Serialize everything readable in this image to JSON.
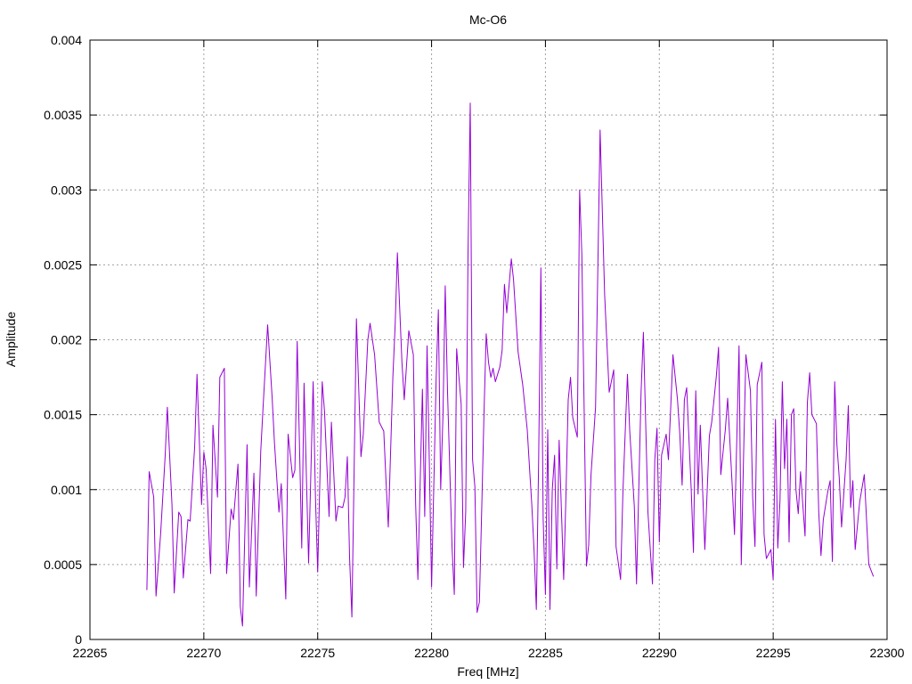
{
  "chart_data": {
    "type": "line",
    "title": "Mc-O6",
    "xlabel": "Freq [MHz]",
    "ylabel": "Amplitude",
    "xlim": [
      22265,
      22300
    ],
    "ylim": [
      0,
      0.004
    ],
    "xticks": [
      22265,
      22270,
      22275,
      22280,
      22285,
      22290,
      22295,
      22300
    ],
    "xtick_labels": [
      "22265",
      "22270",
      "22275",
      "22280",
      "22285",
      "22290",
      "22295",
      "22300"
    ],
    "yticks": [
      0,
      0.0005,
      0.001,
      0.0015,
      0.002,
      0.0025,
      0.003,
      0.0035,
      0.004
    ],
    "ytick_labels": [
      "0",
      "0.0005",
      "0.001",
      "0.0015",
      "0.002",
      "0.0025",
      "0.003",
      "0.0035",
      "0.004"
    ],
    "grid": true,
    "series": [
      {
        "color": "#9400d3",
        "points": [
          [
            22267.5,
            0.00033
          ],
          [
            22267.6,
            0.00112
          ],
          [
            22267.8,
            0.00095
          ],
          [
            22267.9,
            0.00029
          ],
          [
            22268.1,
            0.0007
          ],
          [
            22268.3,
            0.00122
          ],
          [
            22268.4,
            0.00155
          ],
          [
            22268.6,
            0.0009
          ],
          [
            22268.7,
            0.00031
          ],
          [
            22268.9,
            0.00085
          ],
          [
            22269.0,
            0.00082
          ],
          [
            22269.1,
            0.00041
          ],
          [
            22269.3,
            0.0008
          ],
          [
            22269.4,
            0.00079
          ],
          [
            22269.6,
            0.00129
          ],
          [
            22269.7,
            0.00177
          ],
          [
            22269.9,
            0.0009
          ],
          [
            22270.0,
            0.00125
          ],
          [
            22270.1,
            0.00114
          ],
          [
            22270.3,
            0.00044
          ],
          [
            22270.4,
            0.00143
          ],
          [
            22270.6,
            0.00095
          ],
          [
            22270.7,
            0.00175
          ],
          [
            22270.9,
            0.00181
          ],
          [
            22271.0,
            0.00044
          ],
          [
            22271.2,
            0.00087
          ],
          [
            22271.3,
            0.0008
          ],
          [
            22271.5,
            0.00117
          ],
          [
            22271.6,
            0.00022
          ],
          [
            22271.7,
            9e-05
          ],
          [
            22271.9,
            0.0013
          ],
          [
            22272.0,
            0.00035
          ],
          [
            22272.2,
            0.00111
          ],
          [
            22272.3,
            0.00029
          ],
          [
            22272.5,
            0.00126
          ],
          [
            22272.6,
            0.00154
          ],
          [
            22272.8,
            0.0021
          ],
          [
            22273.0,
            0.00161
          ],
          [
            22273.1,
            0.00132
          ],
          [
            22273.3,
            0.00085
          ],
          [
            22273.4,
            0.00104
          ],
          [
            22273.6,
            0.00027
          ],
          [
            22273.7,
            0.00137
          ],
          [
            22273.9,
            0.00108
          ],
          [
            22274.0,
            0.00113
          ],
          [
            22274.1,
            0.00199
          ],
          [
            22274.3,
            0.00061
          ],
          [
            22274.4,
            0.00171
          ],
          [
            22274.5,
            0.00112
          ],
          [
            22274.6,
            0.00051
          ],
          [
            22274.8,
            0.00172
          ],
          [
            22274.9,
            0.00095
          ],
          [
            22275.0,
            0.00045
          ],
          [
            22275.2,
            0.00172
          ],
          [
            22275.3,
            0.00152
          ],
          [
            22275.5,
            0.00082
          ],
          [
            22275.6,
            0.00145
          ],
          [
            22275.8,
            0.00079
          ],
          [
            22275.9,
            0.00089
          ],
          [
            22276.1,
            0.00088
          ],
          [
            22276.2,
            0.00095
          ],
          [
            22276.3,
            0.00122
          ],
          [
            22276.4,
            0.00055
          ],
          [
            22276.5,
            0.00015
          ],
          [
            22276.7,
            0.00214
          ],
          [
            22276.9,
            0.00122
          ],
          [
            22277.0,
            0.00137
          ],
          [
            22277.2,
            0.002
          ],
          [
            22277.3,
            0.00211
          ],
          [
            22277.5,
            0.0019
          ],
          [
            22277.7,
            0.00145
          ],
          [
            22277.9,
            0.00139
          ],
          [
            22278.0,
            0.00106
          ],
          [
            22278.1,
            0.00075
          ],
          [
            22278.3,
            0.00175
          ],
          [
            22278.4,
            0.0021
          ],
          [
            22278.5,
            0.00258
          ],
          [
            22278.7,
            0.00185
          ],
          [
            22278.8,
            0.0016
          ],
          [
            22279.0,
            0.00206
          ],
          [
            22279.2,
            0.0019
          ],
          [
            22279.3,
            0.0009
          ],
          [
            22279.4,
            0.0004
          ],
          [
            22279.6,
            0.00167
          ],
          [
            22279.7,
            0.00082
          ],
          [
            22279.8,
            0.00196
          ],
          [
            22279.9,
            0.0012
          ],
          [
            22280.0,
            0.00035
          ],
          [
            22280.2,
            0.00174
          ],
          [
            22280.3,
            0.0022
          ],
          [
            22280.4,
            0.001
          ],
          [
            22280.5,
            0.0015
          ],
          [
            22280.6,
            0.00236
          ],
          [
            22280.7,
            0.00165
          ],
          [
            22280.9,
            0.00061
          ],
          [
            22281.0,
            0.0003
          ],
          [
            22281.1,
            0.00194
          ],
          [
            22281.3,
            0.00157
          ],
          [
            22281.4,
            0.00048
          ],
          [
            22281.5,
            0.00085
          ],
          [
            22281.6,
            0.00258
          ],
          [
            22281.7,
            0.00358
          ],
          [
            22281.8,
            0.0012
          ],
          [
            22281.9,
            0.00102
          ],
          [
            22282.0,
            0.00018
          ],
          [
            22282.1,
            0.00025
          ],
          [
            22282.2,
            0.00085
          ],
          [
            22282.3,
            0.0015
          ],
          [
            22282.4,
            0.00204
          ],
          [
            22282.5,
            0.00185
          ],
          [
            22282.6,
            0.00175
          ],
          [
            22282.7,
            0.00181
          ],
          [
            22282.8,
            0.00172
          ],
          [
            22283.0,
            0.00182
          ],
          [
            22283.1,
            0.00193
          ],
          [
            22283.2,
            0.00237
          ],
          [
            22283.3,
            0.00218
          ],
          [
            22283.5,
            0.00254
          ],
          [
            22283.6,
            0.0024
          ],
          [
            22283.8,
            0.00192
          ],
          [
            22284.0,
            0.0017
          ],
          [
            22284.2,
            0.0014
          ],
          [
            22284.3,
            0.00115
          ],
          [
            22284.4,
            0.0009
          ],
          [
            22284.5,
            0.0006
          ],
          [
            22284.6,
            0.0002
          ],
          [
            22284.7,
            0.0012
          ],
          [
            22284.8,
            0.00248
          ],
          [
            22284.9,
            0.0008
          ],
          [
            22285.0,
            0.0003
          ],
          [
            22285.1,
            0.0014
          ],
          [
            22285.2,
            0.0002
          ],
          [
            22285.3,
            0.001
          ],
          [
            22285.4,
            0.00123
          ],
          [
            22285.5,
            0.00047
          ],
          [
            22285.6,
            0.00133
          ],
          [
            22285.8,
            0.0004
          ],
          [
            22285.9,
            0.00095
          ],
          [
            22286.0,
            0.0016
          ],
          [
            22286.1,
            0.00175
          ],
          [
            22286.2,
            0.00148
          ],
          [
            22286.4,
            0.00135
          ],
          [
            22286.5,
            0.003
          ],
          [
            22286.6,
            0.00257
          ],
          [
            22286.8,
            0.00049
          ],
          [
            22286.9,
            0.00063
          ],
          [
            22287.0,
            0.0011
          ],
          [
            22287.2,
            0.00155
          ],
          [
            22287.4,
            0.0034
          ],
          [
            22287.6,
            0.0023
          ],
          [
            22287.8,
            0.00165
          ],
          [
            22288.0,
            0.0018
          ],
          [
            22288.1,
            0.00062
          ],
          [
            22288.3,
            0.0004
          ],
          [
            22288.4,
            0.00098
          ],
          [
            22288.6,
            0.00177
          ],
          [
            22288.7,
            0.0014
          ],
          [
            22288.9,
            0.00089
          ],
          [
            22289.0,
            0.00037
          ],
          [
            22289.2,
            0.00165
          ],
          [
            22289.3,
            0.00205
          ],
          [
            22289.5,
            0.00085
          ],
          [
            22289.7,
            0.00037
          ],
          [
            22289.8,
            0.0012
          ],
          [
            22289.9,
            0.00141
          ],
          [
            22290.0,
            0.00065
          ],
          [
            22290.1,
            0.00123
          ],
          [
            22290.3,
            0.00137
          ],
          [
            22290.4,
            0.0012
          ],
          [
            22290.5,
            0.00155
          ],
          [
            22290.6,
            0.0019
          ],
          [
            22290.8,
            0.0016
          ],
          [
            22290.9,
            0.00137
          ],
          [
            22291.0,
            0.00103
          ],
          [
            22291.1,
            0.0016
          ],
          [
            22291.2,
            0.00168
          ],
          [
            22291.4,
            0.001
          ],
          [
            22291.5,
            0.00058
          ],
          [
            22291.6,
            0.00166
          ],
          [
            22291.7,
            0.00097
          ],
          [
            22291.8,
            0.00143
          ],
          [
            22291.9,
            0.001
          ],
          [
            22292.0,
            0.0006
          ],
          [
            22292.2,
            0.00136
          ],
          [
            22292.3,
            0.00145
          ],
          [
            22292.5,
            0.00175
          ],
          [
            22292.6,
            0.00195
          ],
          [
            22292.7,
            0.0011
          ],
          [
            22292.9,
            0.0014
          ],
          [
            22293.0,
            0.00161
          ],
          [
            22293.2,
            0.00103
          ],
          [
            22293.3,
            0.0007
          ],
          [
            22293.5,
            0.00196
          ],
          [
            22293.6,
            0.0005
          ],
          [
            22293.7,
            0.00123
          ],
          [
            22293.8,
            0.0019
          ],
          [
            22294.0,
            0.00166
          ],
          [
            22294.1,
            0.00095
          ],
          [
            22294.2,
            0.00062
          ],
          [
            22294.3,
            0.0017
          ],
          [
            22294.5,
            0.00185
          ],
          [
            22294.6,
            0.0007
          ],
          [
            22294.7,
            0.00054
          ],
          [
            22294.9,
            0.0006
          ],
          [
            22295.0,
            0.0004
          ],
          [
            22295.1,
            0.00147
          ],
          [
            22295.2,
            0.00061
          ],
          [
            22295.3,
            0.00093
          ],
          [
            22295.4,
            0.00172
          ],
          [
            22295.5,
            0.00114
          ],
          [
            22295.6,
            0.00147
          ],
          [
            22295.7,
            0.00065
          ],
          [
            22295.8,
            0.0015
          ],
          [
            22295.9,
            0.00154
          ],
          [
            22296.0,
            0.001
          ],
          [
            22296.1,
            0.00084
          ],
          [
            22296.2,
            0.00112
          ],
          [
            22296.4,
            0.00069
          ],
          [
            22296.5,
            0.00158
          ],
          [
            22296.6,
            0.00178
          ],
          [
            22296.7,
            0.0015
          ],
          [
            22296.9,
            0.00144
          ],
          [
            22297.0,
            0.00085
          ],
          [
            22297.1,
            0.00056
          ],
          [
            22297.2,
            0.0008
          ],
          [
            22297.4,
            0.00099
          ],
          [
            22297.5,
            0.00106
          ],
          [
            22297.6,
            0.00052
          ],
          [
            22297.7,
            0.00172
          ],
          [
            22297.8,
            0.0013
          ],
          [
            22297.9,
            0.00108
          ],
          [
            22298.0,
            0.00075
          ],
          [
            22298.2,
            0.0012
          ],
          [
            22298.3,
            0.00156
          ],
          [
            22298.4,
            0.00088
          ],
          [
            22298.5,
            0.00106
          ],
          [
            22298.6,
            0.0006
          ],
          [
            22298.8,
            0.00092
          ],
          [
            22299.0,
            0.0011
          ],
          [
            22299.2,
            0.0005
          ],
          [
            22299.4,
            0.00042
          ]
        ]
      }
    ]
  }
}
